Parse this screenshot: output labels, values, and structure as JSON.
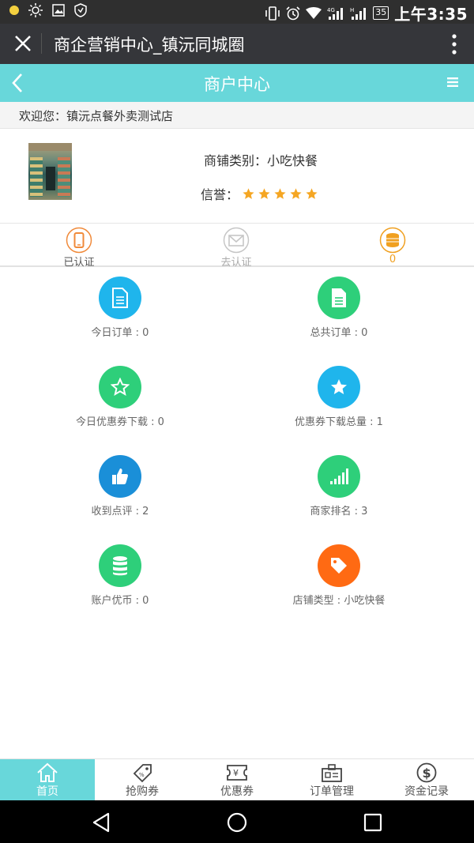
{
  "status_bar": {
    "time": "上午3:35",
    "battery": "35"
  },
  "browser": {
    "title": "商企营销中心_镇沅同城圈"
  },
  "header": {
    "title": "商户中心"
  },
  "welcome_text": "欢迎您：镇沅点餐外卖测试店",
  "profile": {
    "category_label": "商铺类别：",
    "category_value": "小吃快餐",
    "credit_label": "信誉：",
    "stars": 5
  },
  "status_row": [
    {
      "label": "已认证",
      "icon": "phone-icon",
      "color": "#f08a3a"
    },
    {
      "label": "去认证",
      "icon": "envelope-icon",
      "color": "#bbbbbb"
    },
    {
      "label": "0",
      "icon": "coins-icon",
      "color": "#f0a020"
    }
  ],
  "stats": [
    {
      "label": "今日订单 : 0",
      "icon": "document-icon",
      "color": "#1fb5ec"
    },
    {
      "label": "总共订单 : 0",
      "icon": "document-filled-icon",
      "color": "#2ecf7a"
    },
    {
      "label": "今日优惠券下载 : 0",
      "icon": "star-outline-icon",
      "color": "#2ecf7a"
    },
    {
      "label": "优惠券下载总量 : 1",
      "icon": "star-filled-icon",
      "color": "#1fb5ec"
    },
    {
      "label": "收到点评 : 2",
      "icon": "thumbs-up-icon",
      "color": "#1a8fd8"
    },
    {
      "label": "商家排名 : 3",
      "icon": "signal-bars-icon",
      "color": "#2ecf7a"
    },
    {
      "label": "账户优币 : 0",
      "icon": "database-icon",
      "color": "#2ecf7a"
    },
    {
      "label": "店铺类型 : 小吃快餐",
      "icon": "tag-icon",
      "color": "#ff6a13"
    }
  ],
  "tabs": [
    {
      "label": "首页",
      "icon": "home-icon",
      "active": true
    },
    {
      "label": "抢购券",
      "icon": "coupon-tag-icon",
      "active": false
    },
    {
      "label": "优惠券",
      "icon": "yen-ticket-icon",
      "active": false
    },
    {
      "label": "订单管理",
      "icon": "order-icon",
      "active": false
    },
    {
      "label": "资金记录",
      "icon": "dollar-icon",
      "active": false
    }
  ],
  "colors": {
    "accent": "#68d7da",
    "title_bar": "#35363a",
    "status_bar": "#2f2f2f"
  }
}
